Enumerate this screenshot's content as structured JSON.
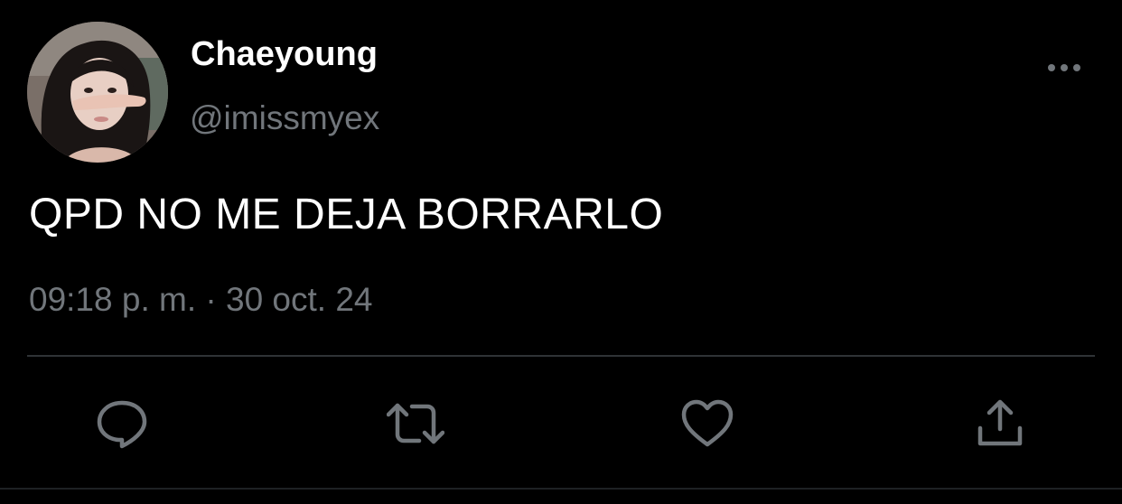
{
  "tweet": {
    "author": {
      "display_name": "Chaeyoung",
      "handle": "@imissmyex"
    },
    "text": "QPD NO ME DEJA BORRARLO",
    "time": "09:18 p. m.",
    "separator": " · ",
    "date": "30 oct. 24"
  },
  "actions": [
    {
      "icon": "reply-icon"
    },
    {
      "icon": "retweet-icon"
    },
    {
      "icon": "like-icon"
    },
    {
      "icon": "share-icon"
    }
  ],
  "colors": {
    "background": "#000000",
    "primary_text": "#ffffff",
    "secondary_text": "#71767b",
    "divider": "#2f3336"
  }
}
